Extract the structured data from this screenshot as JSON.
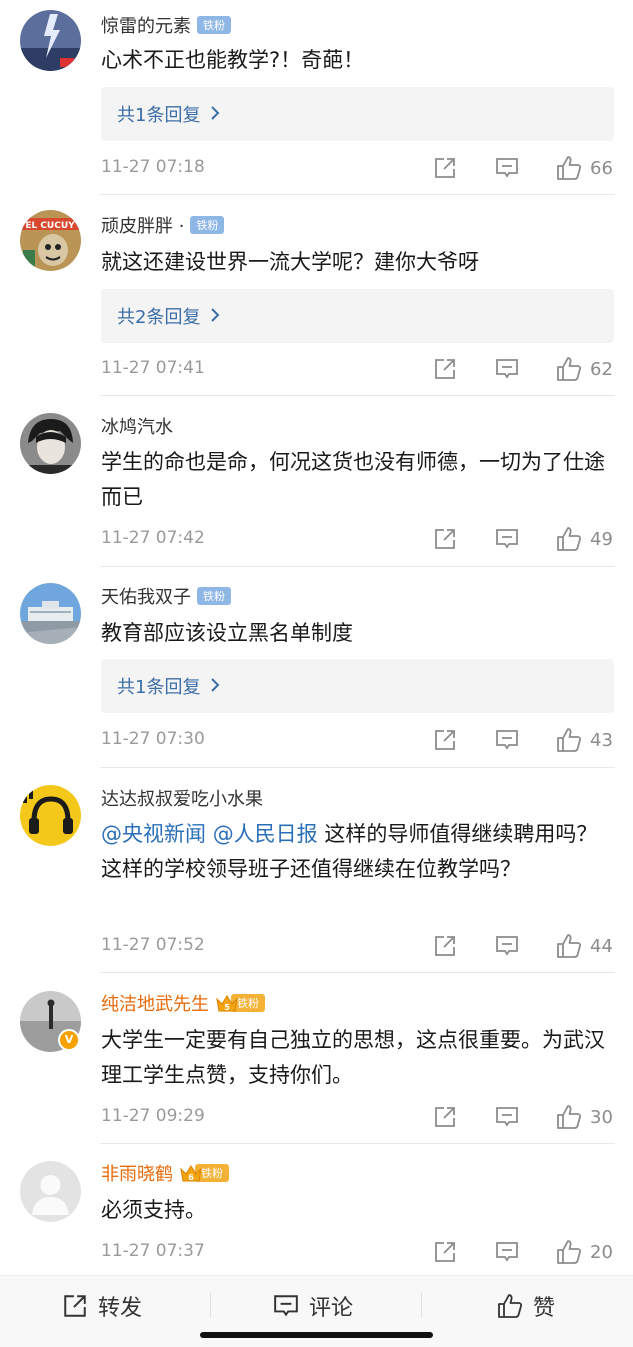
{
  "comments": [
    {
      "user": "惊雷的元素",
      "badge": "铁粉",
      "vip": false,
      "text": "心术不正也能教学?！奇葩！",
      "replies": "共1条回复",
      "time": "11-27 07:18",
      "likes": "66",
      "avatar": "lightning-storm"
    },
    {
      "user": "顽皮胖胖 ·",
      "badge": "铁粉",
      "vip": false,
      "text": "就这还建设世界一流大学呢？建你大爷呀",
      "replies": "共2条回复",
      "time": "11-27 07:41",
      "likes": "62",
      "avatar": "cartoon-el-cucuy"
    },
    {
      "user": "冰鸠汽水",
      "badge": "",
      "vip": false,
      "text": "学生的命也是命，何况这货也没有师德，一切为了仕途而已",
      "replies": "",
      "time": "11-27 07:42",
      "likes": "49",
      "avatar": "dark-hair-person"
    },
    {
      "user": "天佑我双子",
      "badge": "铁粉",
      "vip": false,
      "text": "教育部应该设立黑名单制度",
      "replies": "共1条回复",
      "time": "11-27 07:30",
      "likes": "43",
      "avatar": "building-plaza"
    },
    {
      "user": "达达叔叔爱吃小水果",
      "badge": "",
      "vip": false,
      "mentions": [
        "@央视新闻",
        "@人民日报"
      ],
      "text": " 这样的导师值得继续聘用吗？这样的学校领导班子还值得继续在位教学吗？",
      "replies": "",
      "time": "11-27 07:52",
      "likes": "44",
      "avatar": "headphones-yellow"
    },
    {
      "user": "纯洁地武先生",
      "badge": "铁粉",
      "vip": true,
      "level": "5",
      "text": "大学生一定要有自己独立的思想，这点很重要。为武汉理工学生点赞，支持你们。",
      "replies": "",
      "time": "11-27 09:29",
      "likes": "30",
      "avatar": "person-on-beach"
    },
    {
      "user": "非雨晓鹤",
      "badge": "铁粉",
      "vip": true,
      "level": "6",
      "text": "必须支持。",
      "replies": "",
      "time": "11-27 07:37",
      "likes": "20",
      "avatar": "default-gray"
    }
  ],
  "bottom_bar": {
    "repost_label": "转发",
    "comment_label": "评论",
    "like_label": "赞"
  },
  "colors": {
    "mention": "#2a6fb8",
    "reply_link": "#3c6ea7",
    "vip_name": "#e86b0a",
    "fan_badge": "#8fb7e6"
  }
}
